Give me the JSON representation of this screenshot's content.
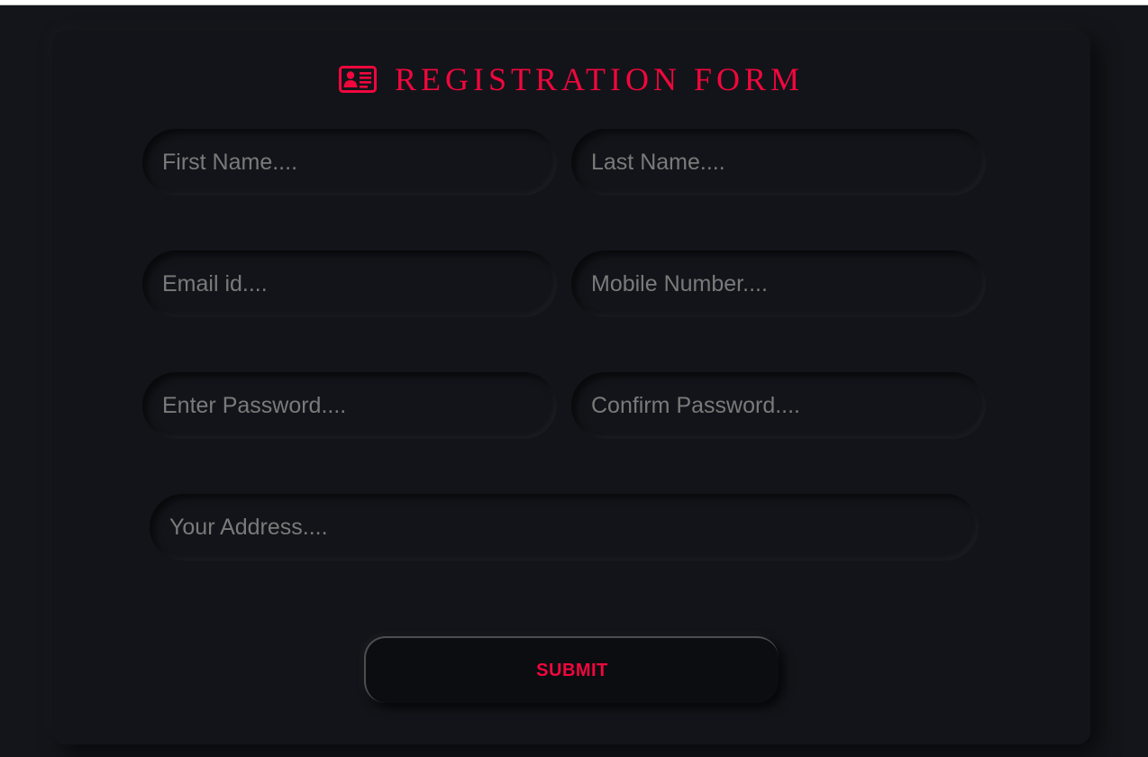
{
  "form": {
    "title": "REGISTRATION FORM",
    "title_icon": "id-card-icon",
    "fields": {
      "first_name": {
        "placeholder": "First Name....",
        "value": ""
      },
      "last_name": {
        "placeholder": "Last Name....",
        "value": ""
      },
      "email": {
        "placeholder": "Email id....",
        "value": ""
      },
      "mobile": {
        "placeholder": "Mobile Number....",
        "value": ""
      },
      "password": {
        "placeholder": "Enter Password....",
        "value": ""
      },
      "confirm_password": {
        "placeholder": "Confirm Password....",
        "value": ""
      },
      "address": {
        "placeholder": "Your Address....",
        "value": ""
      }
    },
    "submit_label": "SUBMIT"
  },
  "colors": {
    "accent": "#f0073d",
    "background": "#14151a",
    "card": "#131419",
    "placeholder": "#7a7a7a"
  }
}
